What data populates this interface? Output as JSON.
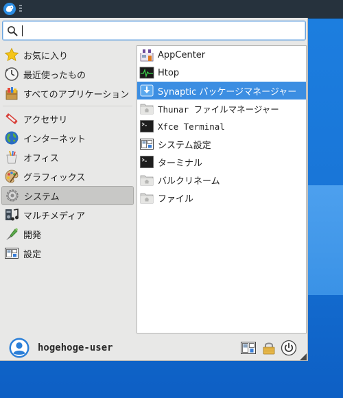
{
  "search": {
    "value": "",
    "placeholder": ""
  },
  "categories": [
    {
      "label": "お気に入り",
      "icon": "star-icon"
    },
    {
      "label": "最近使ったもの",
      "icon": "clock-icon"
    },
    {
      "label": "すべてのアプリケーション",
      "icon": "all-applications-icon"
    },
    {
      "label": "アクセサリ",
      "icon": "accessories-icon"
    },
    {
      "label": "インターネット",
      "icon": "globe-icon"
    },
    {
      "label": "オフィス",
      "icon": "office-icon"
    },
    {
      "label": "グラフィックス",
      "icon": "graphics-palette-icon"
    },
    {
      "label": "システム",
      "icon": "system-gear-icon",
      "selected": true
    },
    {
      "label": "マルチメディア",
      "icon": "multimedia-icon"
    },
    {
      "label": "開発",
      "icon": "development-icon"
    },
    {
      "label": "設定",
      "icon": "settings-icon"
    }
  ],
  "apps": [
    {
      "label": "AppCenter",
      "icon": "appcenter-icon"
    },
    {
      "label": "Htop",
      "icon": "htop-icon"
    },
    {
      "label": "Synaptic パッケージマネージャー",
      "icon": "synaptic-download-icon",
      "selected": true
    },
    {
      "label": "Thunar ファイルマネージャー",
      "icon": "folder-home-icon"
    },
    {
      "label": "Xfce Terminal",
      "icon": "terminal-icon"
    },
    {
      "label": "システム設定",
      "icon": "settings-icon"
    },
    {
      "label": "ターミナル",
      "icon": "terminal-icon"
    },
    {
      "label": "バルクリネーム",
      "icon": "folder-home-icon"
    },
    {
      "label": "ファイル",
      "icon": "folder-home-icon"
    }
  ],
  "user": {
    "name": "hogehoge-user"
  },
  "colors": {
    "selection": "#3c8ee2",
    "panel": "#26323d",
    "menu_bg": "#e8e8e7",
    "desktop": "#1976d8"
  }
}
